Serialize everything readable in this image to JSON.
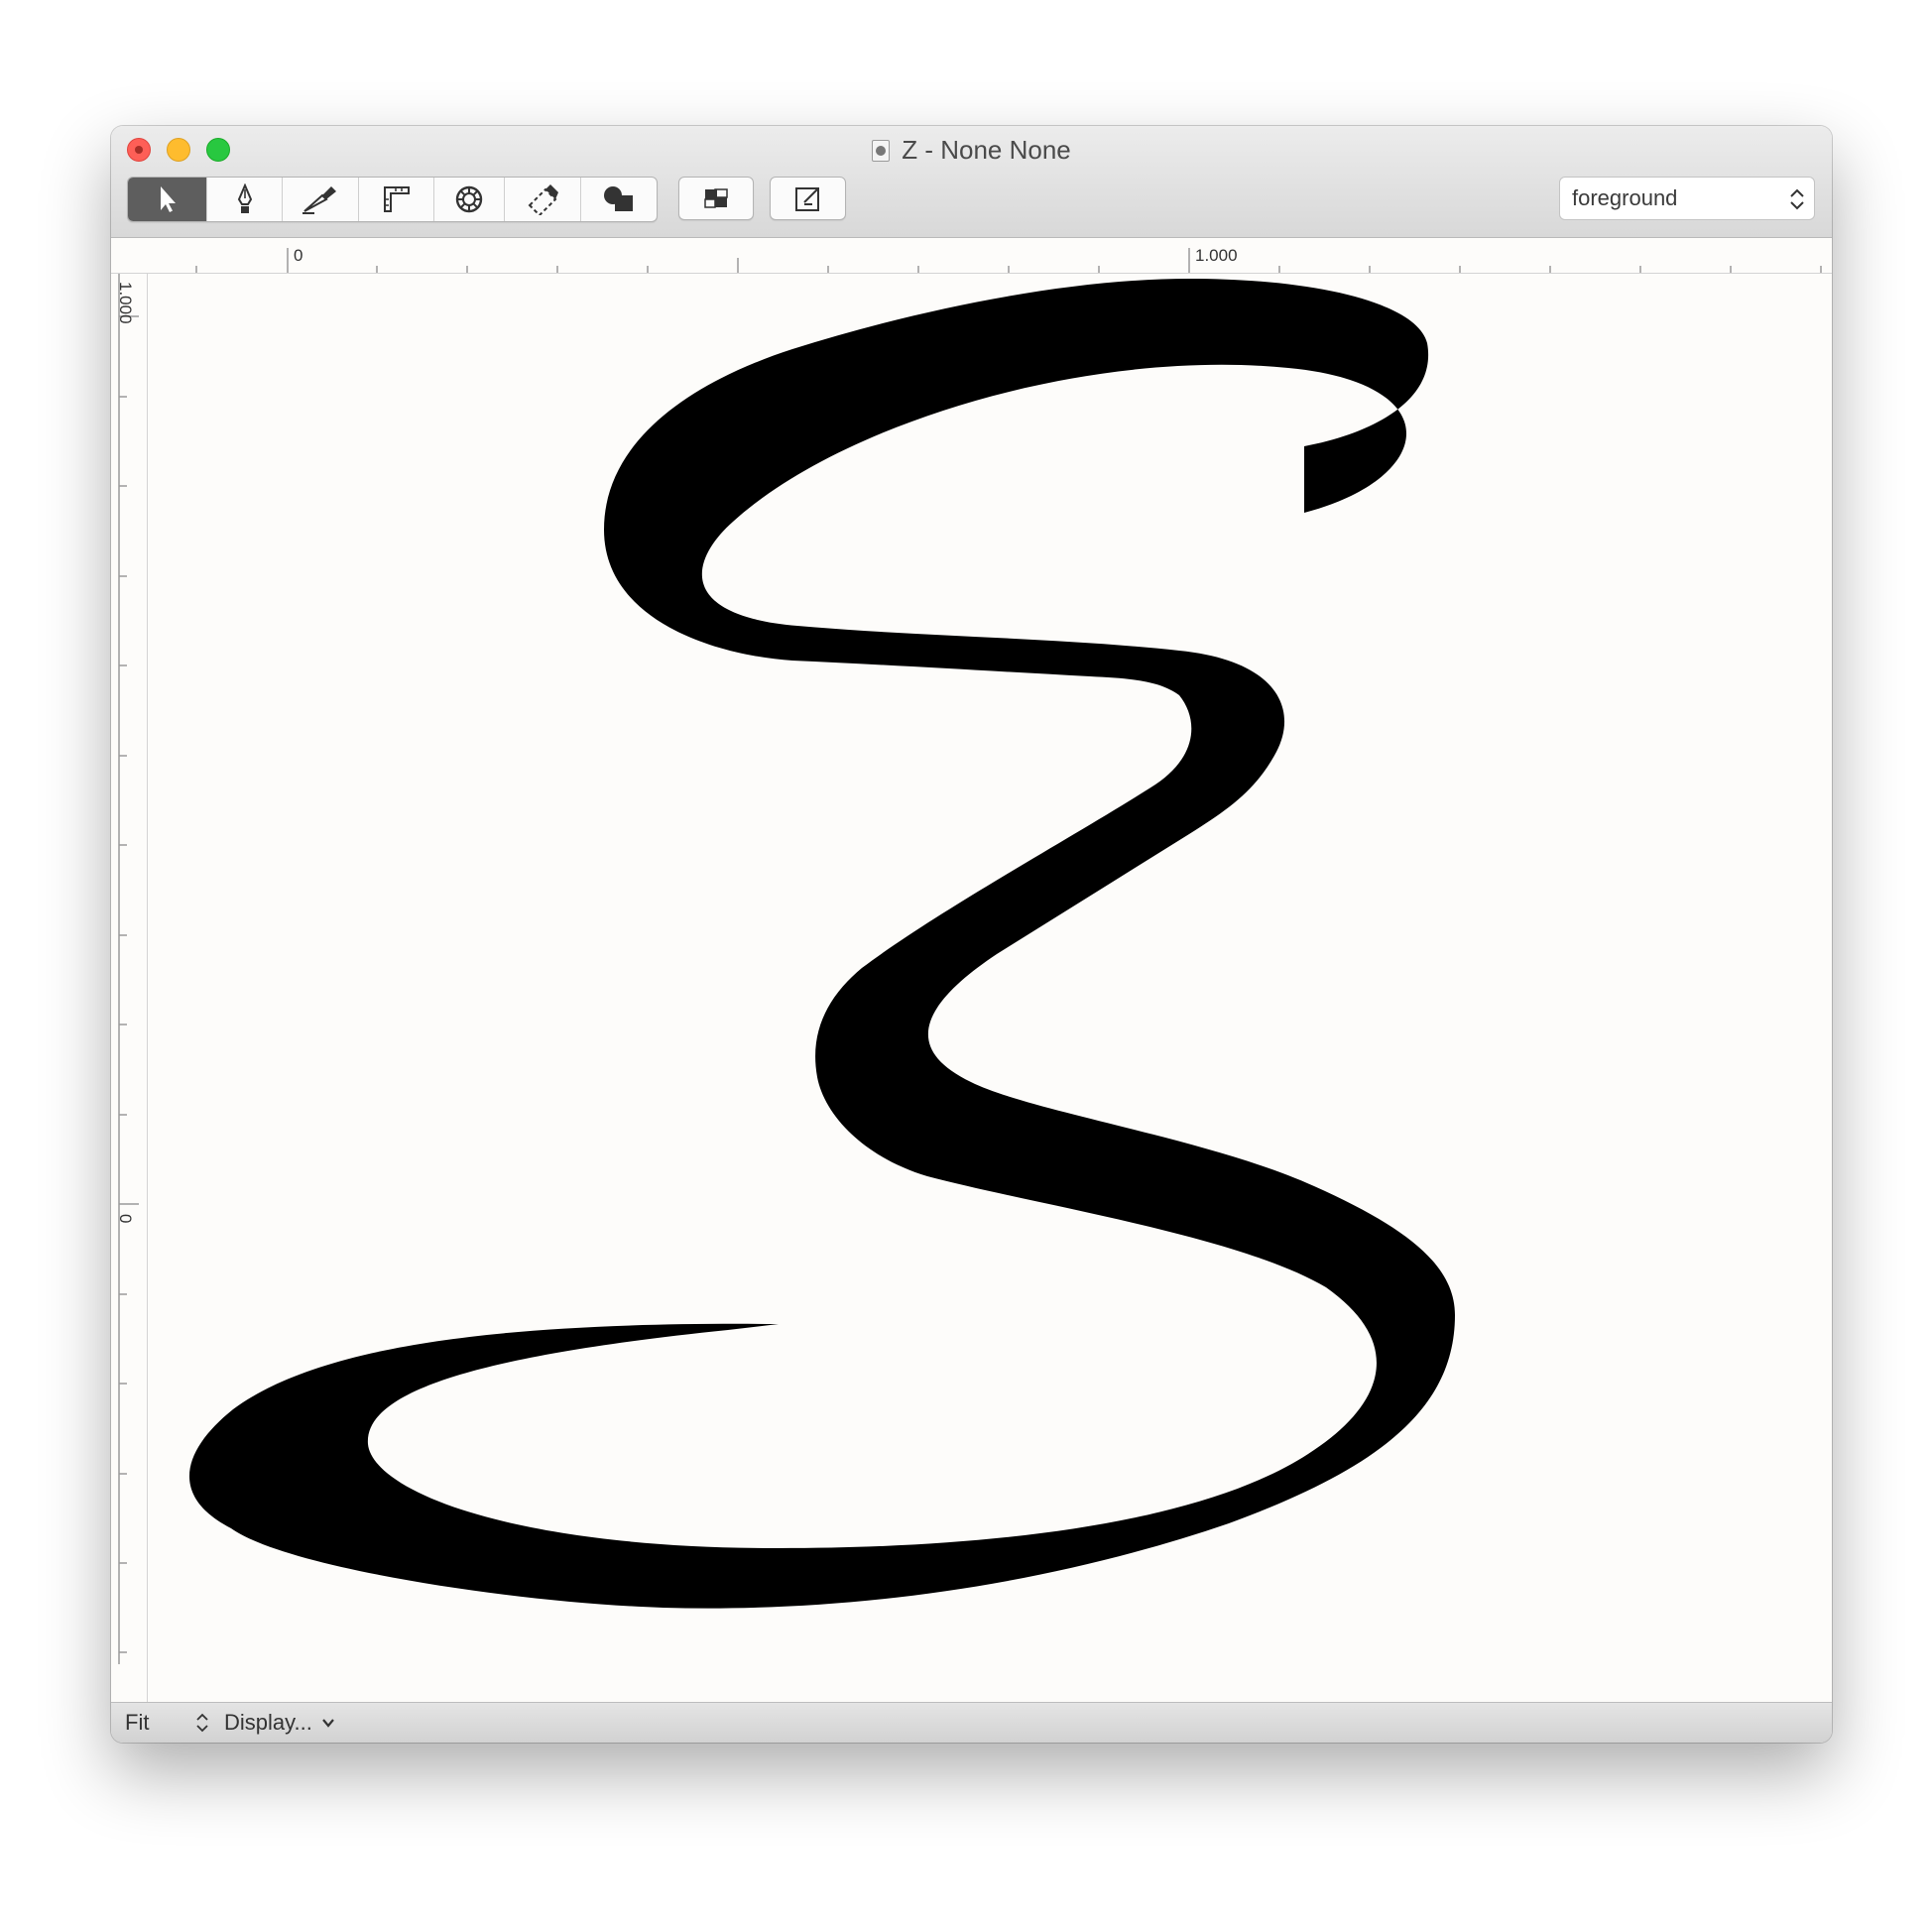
{
  "window": {
    "title": "Z - None None"
  },
  "toolbar": {
    "tools": [
      {
        "name": "select-tool",
        "icon": "arrow-pointer-icon",
        "active": true
      },
      {
        "name": "pen-tool",
        "icon": "pen-nib-icon",
        "active": false
      },
      {
        "name": "knife-tool",
        "icon": "knife-icon",
        "active": false
      },
      {
        "name": "measure-tool",
        "icon": "ruler-square-icon",
        "active": false
      },
      {
        "name": "rotate-tool",
        "icon": "gear-wheel-icon",
        "active": false
      },
      {
        "name": "eraser-tool",
        "icon": "eraser-icon",
        "active": false
      },
      {
        "name": "shape-tool",
        "icon": "shapes-icon",
        "active": false
      }
    ],
    "extra_buttons": [
      {
        "name": "layers-button",
        "icon": "layers-icon"
      },
      {
        "name": "export-button",
        "icon": "export-icon"
      }
    ],
    "layer_select": {
      "value": "foreground"
    }
  },
  "rulers": {
    "horizontal_labels": [
      "0",
      "1.000"
    ],
    "vertical_labels": [
      "1.000",
      "0"
    ]
  },
  "status": {
    "zoom_label": "Fit",
    "display_label": "Display..."
  }
}
